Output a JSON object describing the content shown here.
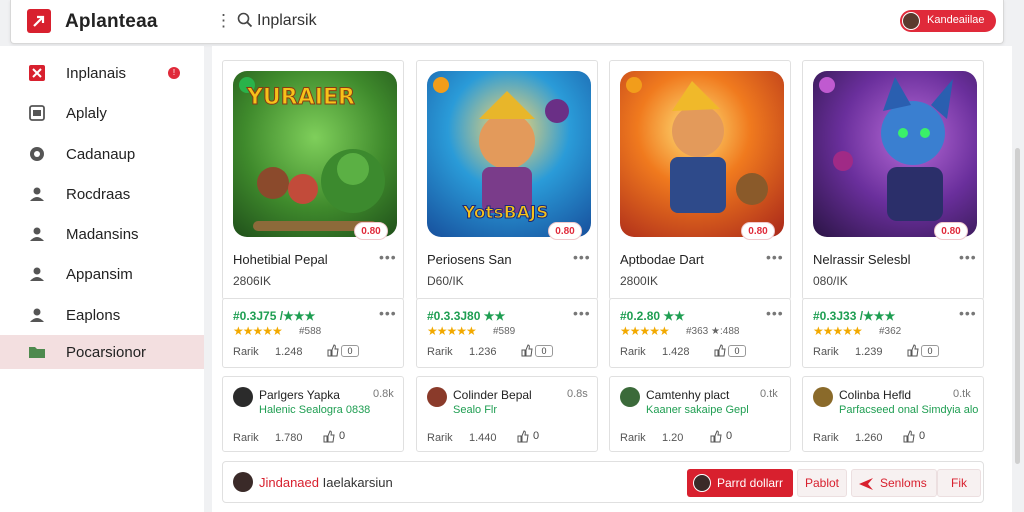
{
  "app": {
    "title": "Aplanteaa"
  },
  "search": {
    "value": "Inplarsik"
  },
  "user": {
    "label": "Kandeaiilae"
  },
  "sidebar": {
    "items": [
      {
        "label": "Inplanais",
        "badge": "!"
      },
      {
        "label": "Aplaly"
      },
      {
        "label": "Cadanaup"
      },
      {
        "label": "Rocdraas"
      },
      {
        "label": "Madansins"
      },
      {
        "label": "Appansim"
      },
      {
        "label": "Eaplons"
      },
      {
        "label": "Pocarsionor"
      }
    ]
  },
  "games": [
    {
      "logo_text": "YURAIER",
      "price": "0.80",
      "title": "Hohetibial Pepal",
      "sub": "2806IK",
      "score": "#0.3J75 /★★★",
      "stars": "★★★★★",
      "count": "#588",
      "rank_label": "Rarik",
      "rank_value": "1.248",
      "like_value": "0"
    },
    {
      "logo_text": "YotsBAJS",
      "price": "0.80",
      "title": "Periosens San",
      "sub": "D60/IK",
      "score": "#0.3.3J80 ★★",
      "stars": "★★★★★",
      "count": "#589",
      "rank_label": "Rarik",
      "rank_value": "1.236",
      "like_value": "0"
    },
    {
      "logo_text": "",
      "price": "0.80",
      "title": "Aptbodae Dart",
      "sub": "2800IK",
      "score": "#0.2.80 ★★",
      "stars": "★★★★★",
      "count": "#363 ★:488",
      "rank_label": "Rarik",
      "rank_value": "1.428",
      "like_value": "0"
    },
    {
      "logo_text": "",
      "price": "0.80",
      "title": "Nelrassir Selesbl",
      "sub": "080/IK",
      "score": "#0.3J33 /★★★",
      "stars": "★★★★★",
      "count": "#362",
      "rank_label": "Rarik",
      "rank_value": "1.239",
      "like_value": "0"
    }
  ],
  "reviews": [
    {
      "name": "Parlgers Yapka",
      "time": "0.8k",
      "text": "Halenic Sealogra 0838",
      "rank_label": "Rarik",
      "rank_value": "1.780",
      "like_value": "0"
    },
    {
      "name": "Colinder Bepal",
      "time": "0.8s",
      "text": "Sealo Flr",
      "rank_label": "Rarik",
      "rank_value": "1.440",
      "like_value": "0"
    },
    {
      "name": "Camtenhy plact",
      "time": "0.tk",
      "text": "Kaaner sakaipe Gepl",
      "rank_label": "Rarik",
      "rank_value": "1.20",
      "like_value": "0"
    },
    {
      "name": "Colinba Hefld",
      "time": "0.tk",
      "text": "Parfacseed onal Simdyia alo",
      "rank_label": "Rarik",
      "rank_value": "1.260",
      "like_value": "0"
    }
  ],
  "bottom": {
    "text_red": "Jindanaed",
    "text_dark": "Iaelakarsiun",
    "primary_label": "Parrd dollarr",
    "btn1": "Pablot",
    "btn2": "Senloms",
    "btn3": "Fik"
  },
  "colors": {
    "accent": "#d8202e",
    "green": "#1f9e52",
    "star": "#f2a900"
  }
}
